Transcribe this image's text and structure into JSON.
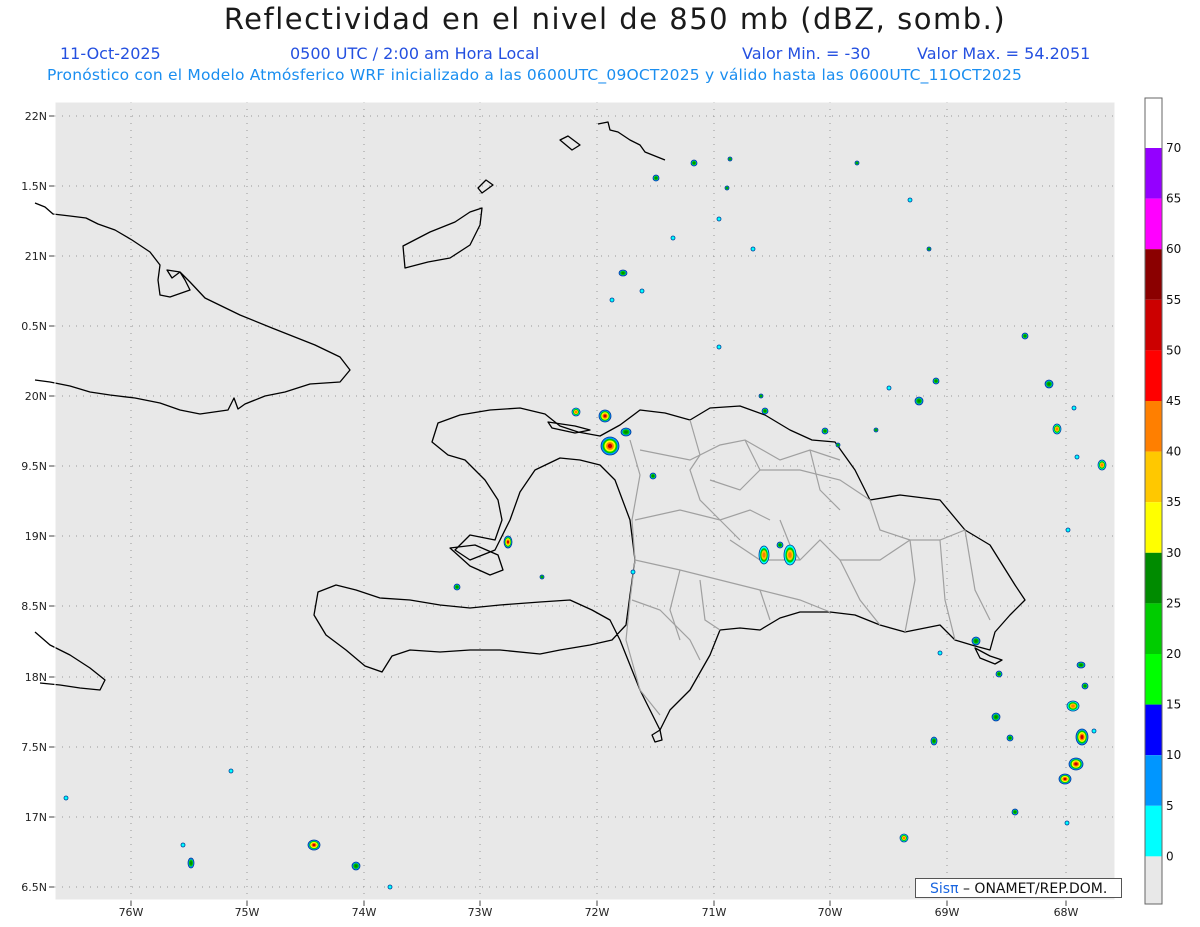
{
  "header": {
    "title": "Reflectividad en el nivel de 850 mb (dBZ, somb.)",
    "date": "11-Oct-2025",
    "time": "0500 UTC / 2:00 am Hora Local",
    "valmin": "Valor Min. = -30",
    "valmax": "Valor Max. = 54.2051",
    "subtitle": "Pronóstico con el Modelo Atmósferico WRF inicializado a las 0600UTC_09OCT2025 y válido hasta las  0600UTC_11OCT2025"
  },
  "lat_labels": [
    "22N",
    "1.5N",
    "21N",
    "0.5N",
    "20N",
    "9.5N",
    "19N",
    "8.5N",
    "18N",
    "7.5N",
    "17N",
    "6.5N"
  ],
  "lon_labels": [
    "76W",
    "75W",
    "74W",
    "73W",
    "72W",
    "71W",
    "70W",
    "69W",
    "68W"
  ],
  "colorbar": {
    "labels": [
      "70",
      "65",
      "60",
      "55",
      "50",
      "45",
      "40",
      "35",
      "30",
      "25",
      "20",
      "15",
      "10",
      "5",
      "0"
    ],
    "colors": [
      "#9400ff",
      "#ff00ff",
      "#8b0000",
      "#cc0000",
      "#ff0000",
      "#ff7f00",
      "#ffc800",
      "#ffff00",
      "#008b00",
      "#00cc00",
      "#00ff00",
      "#0000ff",
      "#0096ff",
      "#00ffff"
    ]
  },
  "credit": {
    "sis": "Sis",
    "pi": "π",
    "rest": "– ONAMET/REP.DOM."
  },
  "icons": {
    "credit_logo": "pi-symbol-icon"
  }
}
